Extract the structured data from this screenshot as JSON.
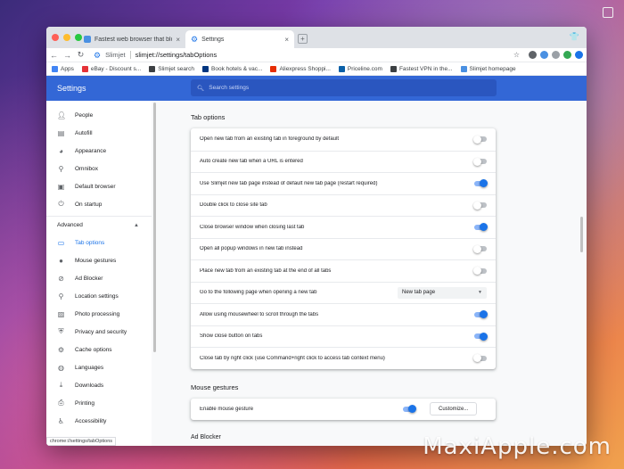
{
  "browser": {
    "tabs": [
      {
        "title": "Fastest web browser that blocks"
      },
      {
        "title": "Settings"
      }
    ],
    "omnibox": {
      "brand": "Slimjet",
      "url": "slimjet://settings/tabOptions"
    },
    "bookmarks": [
      {
        "label": "Apps",
        "color": "#4285f4"
      },
      {
        "label": "eBay - Discount s...",
        "color": "#e53238"
      },
      {
        "label": "Slimjet search",
        "color": "#3c4043"
      },
      {
        "label": "Book hotels & vac...",
        "color": "#003580"
      },
      {
        "label": "Aliexpress Shoppi...",
        "color": "#e62e04"
      },
      {
        "label": "Priceline.com",
        "color": "#0a60a8"
      },
      {
        "label": "Fastest VPN in the...",
        "color": "#3c4043"
      },
      {
        "label": "Slimjet homepage",
        "color": "#4a90e2"
      }
    ],
    "status_url": "chrome://settings/tabOptions"
  },
  "header": {
    "title": "Settings",
    "search_placeholder": "Search settings"
  },
  "sidebar": {
    "items": [
      {
        "label": "People",
        "icon": "person-icon"
      },
      {
        "label": "Autofill",
        "icon": "clipboard-icon"
      },
      {
        "label": "Appearance",
        "icon": "palette-icon"
      },
      {
        "label": "Omnibox",
        "icon": "search-icon"
      },
      {
        "label": "Default browser",
        "icon": "browser-icon"
      },
      {
        "label": "On startup",
        "icon": "power-icon"
      }
    ],
    "advanced_label": "Advanced",
    "advanced_items": [
      {
        "label": "Tab options",
        "icon": "tab-icon",
        "active": true
      },
      {
        "label": "Mouse gestures",
        "icon": "mouse-icon"
      },
      {
        "label": "Ad Blocker",
        "icon": "block-icon"
      },
      {
        "label": "Location settings",
        "icon": "location-icon"
      },
      {
        "label": "Photo processing",
        "icon": "photo-icon"
      },
      {
        "label": "Privacy and security",
        "icon": "shield-icon"
      },
      {
        "label": "Cache options",
        "icon": "gear-icon"
      },
      {
        "label": "Languages",
        "icon": "globe-icon"
      },
      {
        "label": "Downloads",
        "icon": "download-icon"
      },
      {
        "label": "Printing",
        "icon": "printer-icon"
      },
      {
        "label": "Accessibility",
        "icon": "accessibility-icon"
      }
    ]
  },
  "tab_options": {
    "title": "Tab options",
    "rows": [
      {
        "label": "Open new tab from an existing tab in foreground by default",
        "on": false
      },
      {
        "label": "Auto create new tab when a URL is entered",
        "on": false
      },
      {
        "label": "Use Slimjet new tab page instead of default new tab page (restart required)",
        "on": true
      },
      {
        "label": "Double click to close site tab",
        "on": false
      },
      {
        "label": "Close browser window when closing last tab",
        "on": true
      },
      {
        "label": "Open all popup windows in new tab instead",
        "on": false
      },
      {
        "label": "Place new tab from an existing tab at the end of all tabs",
        "on": false
      }
    ],
    "dropdown_label": "Go to the following page when opening a new tab",
    "dropdown_value": "New tab page",
    "rows2": [
      {
        "label": "Allow using mousewheel to scroll through the tabs",
        "on": true
      },
      {
        "label": "Show close button on tabs",
        "on": true
      },
      {
        "label": "Close tab by right click (use Command+right click to access tab context menu)",
        "on": false
      }
    ]
  },
  "mouse_gestures": {
    "title": "Mouse gestures",
    "enable_label": "Enable mouse gesture",
    "enabled": true,
    "customize_label": "Customize..."
  },
  "next_section": "Ad Blocker",
  "watermark": "MaxiApple.com"
}
